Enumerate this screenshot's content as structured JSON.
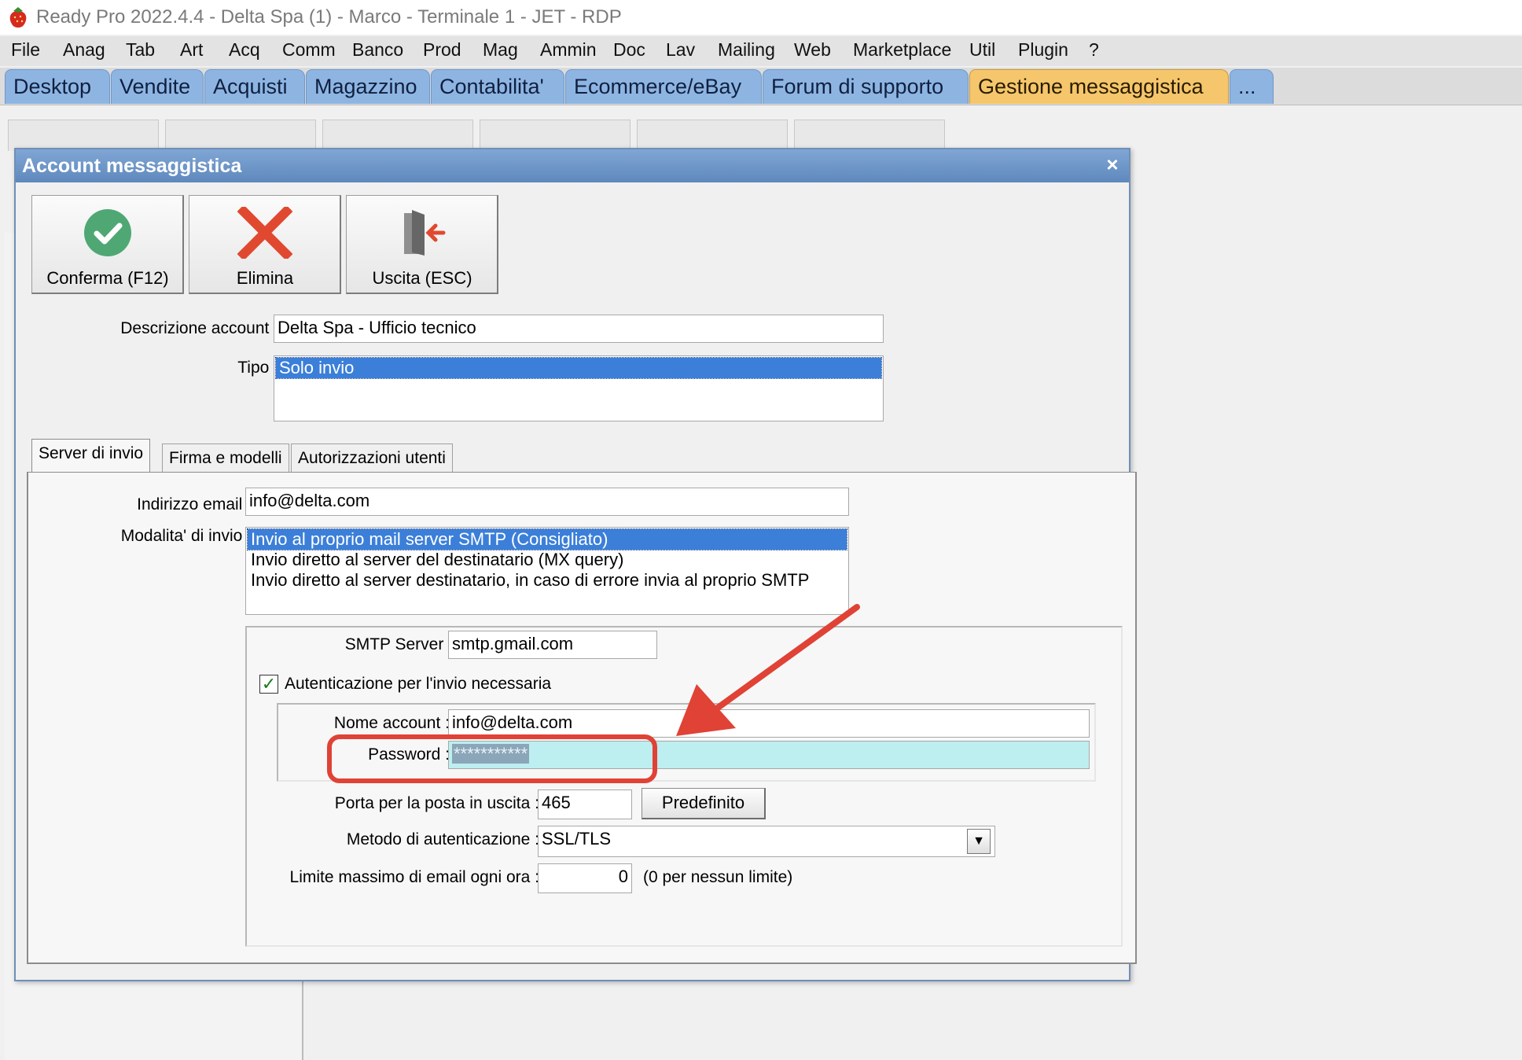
{
  "window": {
    "title": "Ready Pro 2022.4.4 - Delta Spa (1) - Marco - Terminale 1 - JET - RDP"
  },
  "menu": [
    "File",
    "Anag",
    "Tab",
    "Art",
    "Acq",
    "Comm",
    "Banco",
    "Prod",
    "Mag",
    "Ammin",
    "Doc",
    "Lav",
    "Mailing",
    "Web",
    "Marketplace",
    "Util",
    "Plugin",
    "?"
  ],
  "main_tabs": [
    "Desktop",
    "Vendite",
    "Acquisti",
    "Magazzino",
    "Contabilita'",
    "Ecommerce/eBay",
    "Forum di supporto",
    "Gestione messaggistica",
    "..."
  ],
  "active_tab": "Gestione messaggistica",
  "dialog": {
    "title": "Account messaggistica",
    "close_symbol": "×",
    "toolbar": {
      "confirm_label": "Conferma (F12)",
      "delete_label": "Elimina",
      "exit_label": "Uscita (ESC)"
    },
    "description_label": "Descrizione account :",
    "description_value": "Delta Spa - Ufficio tecnico",
    "type_label": "Tipo :",
    "type_options": [
      "Solo invio"
    ],
    "type_selected": "Solo invio",
    "inner_tabs": [
      "Server di invio",
      "Firma e modelli",
      "Autorizzazioni utenti"
    ],
    "inner_active_tab": "Server di invio",
    "server": {
      "email_label": "Indirizzo email :",
      "email_value": "info@delta.com",
      "mode_label": "Modalita' di invio :",
      "mode_options": [
        "Invio al proprio mail server SMTP (Consigliato)",
        "Invio diretto al server del destinatario (MX query)",
        "Invio diretto al server destinatario, in caso di errore invia al proprio SMTP"
      ],
      "mode_selected_index": 0,
      "smtp_label": "SMTP Server :",
      "smtp_value": "smtp.gmail.com",
      "auth_checkbox_label": "Autenticazione per l'invio necessaria",
      "auth_checked": true,
      "account_name_label": "Nome account :",
      "account_name_value": "info@delta.com",
      "password_label": "Password :",
      "password_value": "***********",
      "port_label": "Porta per la posta in uscita :",
      "port_value": "465",
      "default_button_label": "Predefinito",
      "auth_method_label": "Metodo di autenticazione :",
      "auth_method_value": "SSL/TLS",
      "limit_label": "Limite massimo di email ogni ora :",
      "limit_value": "0",
      "limit_hint": "(0 per nessun limite)"
    }
  },
  "colors": {
    "tab_blue": "#8eb5e2",
    "tab_active": "#f5c66b",
    "selection_blue": "#3b7fd9",
    "annotation_red": "#e04236",
    "password_bg": "#bdeef0"
  }
}
